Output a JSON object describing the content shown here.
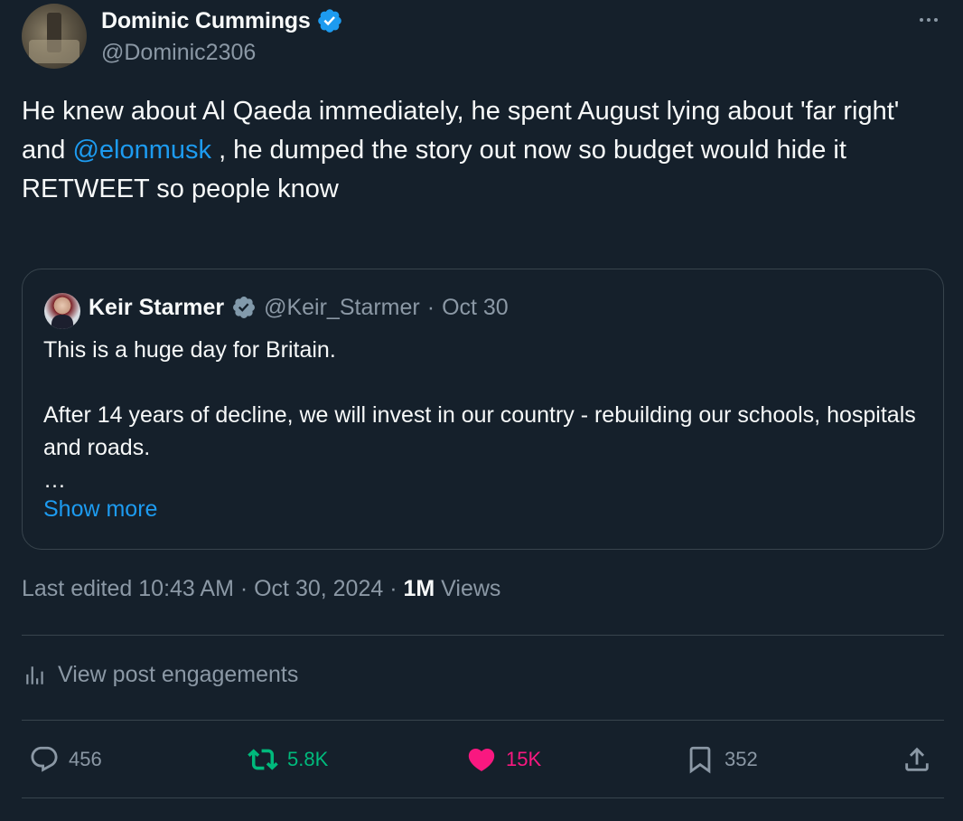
{
  "author": {
    "display_name": "Dominic Cummings",
    "handle": "@Dominic2306"
  },
  "tweet": {
    "text_part1": "He knew about Al Qaeda immediately, he spent August lying about 'far right' and ",
    "mention": "@elonmusk",
    "text_part2": " , he dumped the story out now so budget would hide it",
    "text_line_last": "RETWEET so people know"
  },
  "quote": {
    "display_name": "Keir Starmer",
    "handle": "@Keir_Starmer",
    "separator": "·",
    "date": "Oct 30",
    "text": "This is a huge day for Britain.\n\nAfter 14 years of decline, we will invest in our country - rebuilding our schools, hospitals and roads.\n…",
    "show_more": "Show more"
  },
  "meta": {
    "edited": "Last edited 10:43 AM · Oct 30, 2024 · ",
    "views_count": "1M",
    "views_label": " Views"
  },
  "engagements_label": "View post engagements",
  "actions": {
    "replies": "456",
    "reposts": "5.8K",
    "likes": "15K",
    "bookmarks": "352"
  },
  "colors": {
    "background": "#15202b",
    "link": "#1d9bf0",
    "repost_active": "#00ba7c",
    "like_active": "#f91880",
    "muted": "#8b98a5",
    "verified_blue": "#1d9bf0",
    "verified_gray": "#829aab"
  },
  "icons": {
    "verified": "verified-badge-icon",
    "more": "more-icon",
    "reply": "reply-icon",
    "repost": "repost-icon",
    "like": "heart-icon",
    "bookmark": "bookmark-icon",
    "share": "share-icon",
    "analytics": "analytics-icon"
  }
}
